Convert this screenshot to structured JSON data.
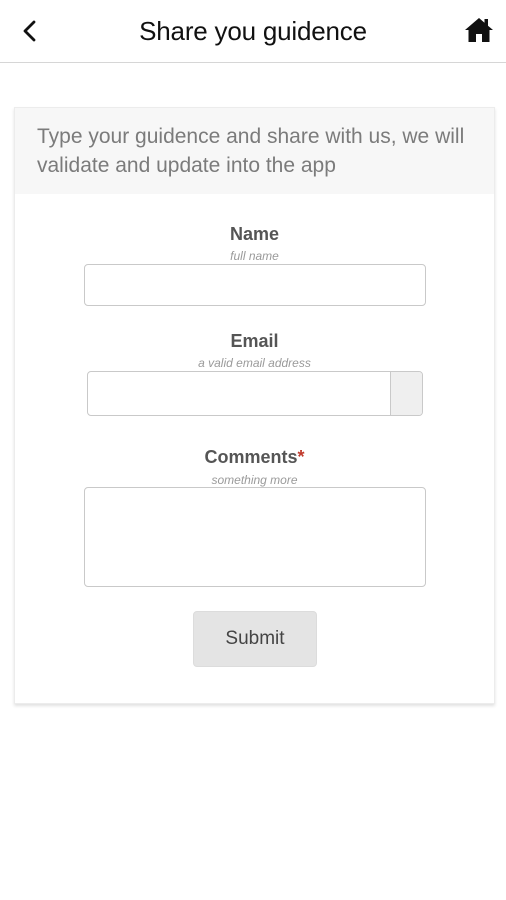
{
  "header": {
    "title": "Share you guidence",
    "back_icon": "chevron-left-icon",
    "home_icon": "home-icon"
  },
  "form": {
    "intro": "Type your guidence and share with us, we will validate and update into the app",
    "name": {
      "label": "Name",
      "hint": "full name",
      "value": "",
      "placeholder": ""
    },
    "email": {
      "label": "Email",
      "hint": "a valid email address",
      "value": "",
      "placeholder": ""
    },
    "comments": {
      "label": "Comments",
      "required_marker": "*",
      "hint": "something more",
      "value": "",
      "placeholder": ""
    },
    "submit_label": "Submit"
  },
  "colors": {
    "required_marker": "#c0392b",
    "submit_background": "#e4e4e4",
    "header_background": "#f7f7f7"
  }
}
